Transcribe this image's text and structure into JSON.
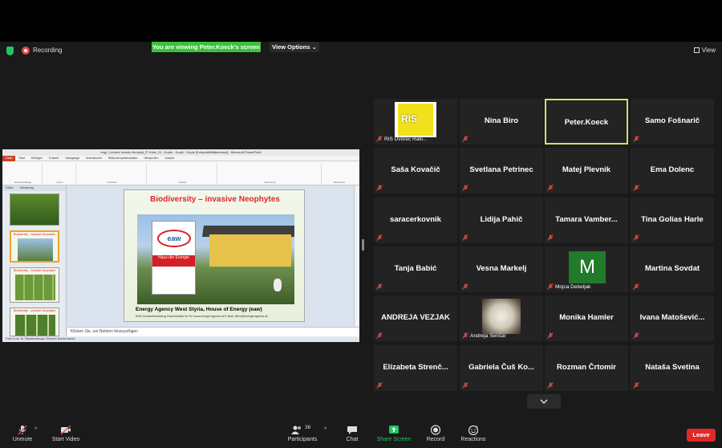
{
  "topbar": {
    "recording": "Recording",
    "viewing_banner": "You are viewing Peter.Koeck's screen",
    "view_options": "View Options ⌄",
    "view": "View"
  },
  "shared_screen": {
    "window_title": "engl._Lecture Invasiv Neophyt_P. Köck_21 - Kopie - Kopie - Kopie [Kompatibilitätsmodus] - Microsoft PowerPoint",
    "ribbon_tabs": [
      "Datei",
      "Start",
      "Einfügen",
      "Entwurf",
      "Übergänge",
      "Animationen",
      "Bildschirmpräsentation",
      "Überprüfen",
      "Ansicht"
    ],
    "ribbon_groups": [
      "Zwischenablage",
      "Folien",
      "Schriftart",
      "Absatz",
      "Zeichnung",
      "Bearbeiten"
    ],
    "panel_tabs": [
      "Folien",
      "Gliederung"
    ],
    "slide_title": "Biodiversity – invasive Neophytes",
    "slide_sign_logo": "eaw",
    "slide_sign_text": "Haus der Energie",
    "slide_caption": "Energy Agency West Styria, House of Energy (eaw)",
    "slide_address": "8160 Deutschlandsberg Grazerstraße 9a  Tel: www.energie.agentur.at   E-Mail: office@energie.agentur.at",
    "thumb_titles": [
      "Biodiversity – invasive Neophytes",
      "Biodiversity – invasive Neophytes",
      "Biodiversity – invasive Neophytes"
    ],
    "notes_placeholder": "Klicken Sie, um Notizen hinzuzufügen",
    "status_left": "Folie 5 von 16   \"Standarddesign\"   Deutsch (Deutschland)"
  },
  "participants": [
    {
      "name": "",
      "label": "RIS Dvorec Raki...",
      "logo": "RIS",
      "muted": true
    },
    {
      "name": "Nina Biro",
      "muted": true
    },
    {
      "name": "Peter.Koeck",
      "muted": false,
      "active_speaker": true
    },
    {
      "name": "Samo Fošnarič",
      "muted": true
    },
    {
      "name": "Saša Kovačič",
      "muted": true
    },
    {
      "name": "Svetlana Petrinec",
      "muted": true
    },
    {
      "name": "Matej Plevnik",
      "muted": true
    },
    {
      "name": "Ema Dolenc",
      "muted": true
    },
    {
      "name": "saracerkovnik",
      "muted": true
    },
    {
      "name": "Lidija Pahič",
      "muted": true
    },
    {
      "name": "Tamara  Vamber...",
      "muted": true
    },
    {
      "name": "Tina Golias Harle",
      "muted": true
    },
    {
      "name": "Tanja Babić",
      "muted": true
    },
    {
      "name": "Vesna Markelj",
      "muted": true
    },
    {
      "name": "",
      "label": "Mojca Debeljak",
      "avatar_letter": "M",
      "muted": true
    },
    {
      "name": "Martina Sovdat",
      "muted": true
    },
    {
      "name": "ANDREJA VEZJAK",
      "muted": true
    },
    {
      "name": "",
      "label": "Andreja Senčar",
      "photo": "flower",
      "muted": true
    },
    {
      "name": "Monika Hamler",
      "muted": true
    },
    {
      "name": "Ivana  Matošević...",
      "muted": true
    },
    {
      "name": "Elizabeta  Strenč...",
      "muted": true
    },
    {
      "name": "Gabriela Čuš Ko...",
      "muted": true
    },
    {
      "name": "Rozman Črtomir",
      "muted": true
    },
    {
      "name": "Nataša Svetina",
      "muted": true
    }
  ],
  "toolbar": {
    "unmute": "Unmute",
    "start_video": "Start Video",
    "participants": "Participants",
    "participants_count": "36",
    "chat": "Chat",
    "share_screen": "Share Screen",
    "record": "Record",
    "reactions": "Reactions",
    "leave": "Leave"
  },
  "colors": {
    "viewing_banner": "#3ac23a",
    "active_speaker_border": "#cbe36a",
    "share_screen_icon": "#23c55e",
    "leave": "#e02828",
    "muted_icon": "#e34b4b"
  }
}
